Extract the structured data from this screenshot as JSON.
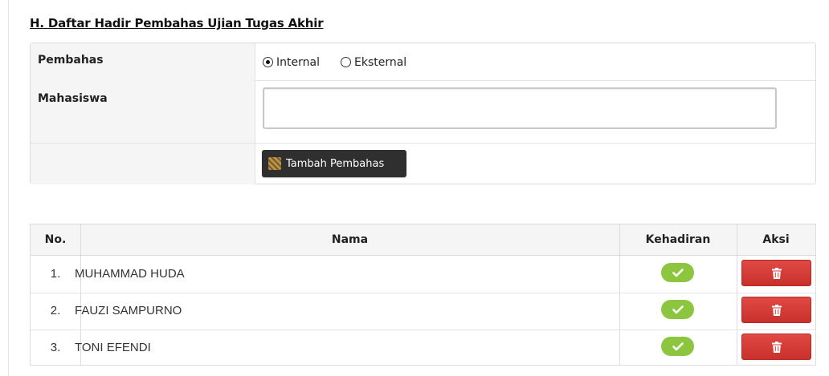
{
  "section": {
    "title": "H. Daftar Hadir Pembahas Ujian Tugas Akhir"
  },
  "form": {
    "pembahas_label": "Pembahas",
    "radio_options": [
      {
        "label": "Internal",
        "checked": true
      },
      {
        "label": "Eksternal",
        "checked": false
      }
    ],
    "mahasiswa_label": "Mahasiswa",
    "mahasiswa_value": "",
    "add_button_label": "Tambah Pembahas",
    "add_button_icon": "grid-icon"
  },
  "table": {
    "headers": {
      "no": "No.",
      "nama": "Nama",
      "kehadiran": "Kehadiran",
      "aksi": "Aksi"
    },
    "rows": [
      {
        "no": "1.",
        "nama": "MUHAMMAD HUDA",
        "hadir": true
      },
      {
        "no": "2.",
        "nama": "FAUZI SAMPURNO",
        "hadir": true
      },
      {
        "no": "3.",
        "nama": "TONI EFENDI",
        "hadir": true
      }
    ],
    "kehadiran_icon": "check-icon",
    "aksi_icon": "trash-icon"
  },
  "colors": {
    "check_badge": "#8cc63f",
    "delete_button": "#d9534f",
    "add_button": "#2f2f2f"
  }
}
